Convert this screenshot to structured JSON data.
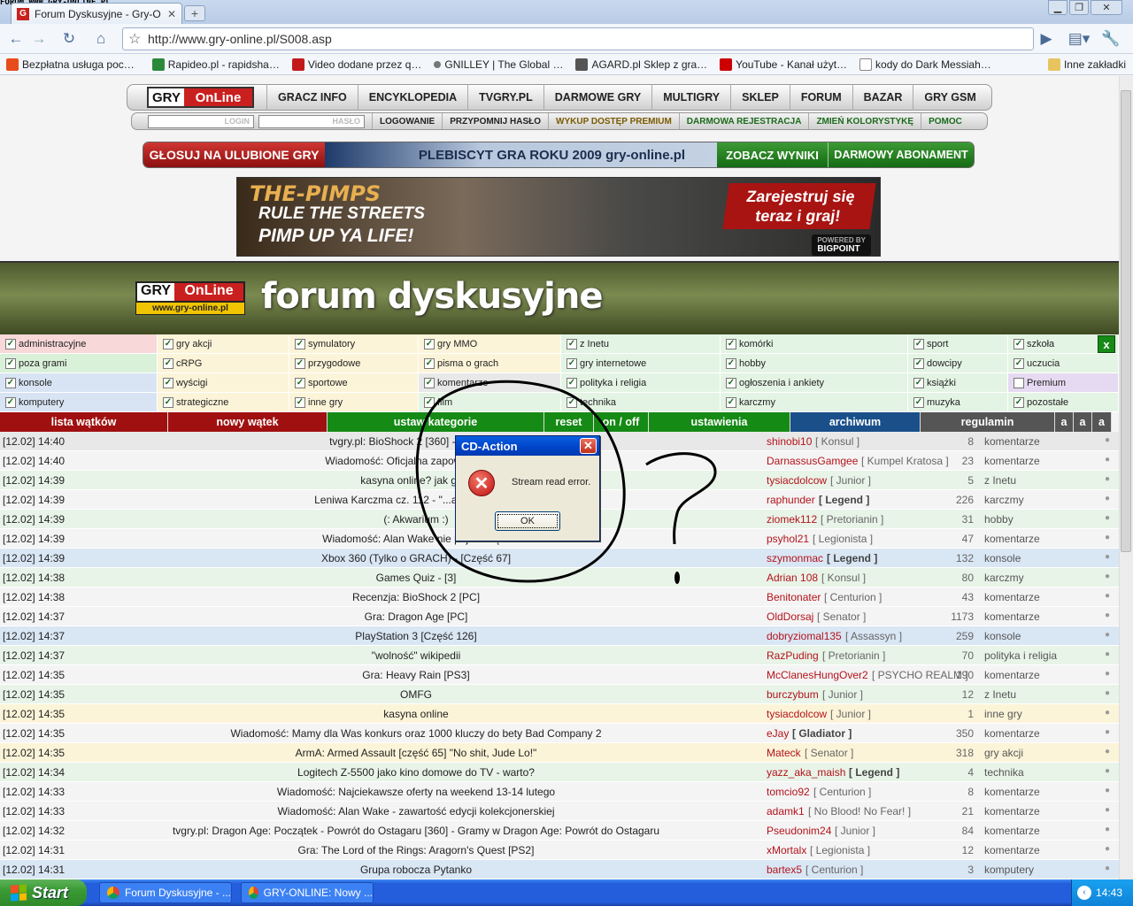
{
  "browser": {
    "watermark": "FORUM.WWW.GRY-ONLINE.PL",
    "tab_title": "Forum Dyskusyjne - Gry-O…",
    "favicon_letter": "G",
    "url": "http://www.gry-online.pl/S008.asp",
    "bookmarks": [
      {
        "label": "Bezpłatna usługa poc…",
        "color": "#e84c1c"
      },
      {
        "label": "Rapideo.pl - rapidsha…",
        "color": "#2a8a3a"
      },
      {
        "label": "Video dodane przez q…",
        "color": "#c21a1a"
      },
      {
        "label": "GNILLEY | The Global …",
        "color": "#777777"
      },
      {
        "label": "AGARD.pl Sklep z gra…",
        "color": "#555555"
      },
      {
        "label": "YouTube - Kanał użyt…",
        "color": "#cc0000"
      },
      {
        "label": "kody do Dark Messiah…",
        "color": "#ffffff"
      }
    ],
    "other_bookmarks": "Inne zakładki"
  },
  "site": {
    "logo_gry": "GRY",
    "logo_online": "OnLine",
    "nav": [
      "GRACZ INFO",
      "ENCYKLOPEDIA",
      "TVGRY.PL",
      "DARMOWE GRY",
      "MULTIGRY",
      "SKLEP",
      "FORUM",
      "BAZAR",
      "GRY GSM"
    ],
    "login_placeholder": "LOGIN",
    "password_placeholder": "HASŁO",
    "subnav": [
      "LOGOWANIE",
      "PRZYPOMNIJ HASŁO",
      "WYKUP DOSTĘP PREMIUM",
      "DARMOWA REJESTRACJA",
      "ZMIEŃ KOLORYSTYKĘ",
      "POMOC"
    ],
    "vote": {
      "left": "GŁOSUJ NA ULUBIONE GRY",
      "middle": "PLEBISCYT GRA ROKU 2009 gry-online.pl",
      "results": "ZOBACZ WYNIKI",
      "subscription": "DARMOWY ABONAMENT"
    },
    "banner": {
      "brand": "THE-PIMPS",
      "line1": "RULE THE STREETS",
      "line2": "PIMP UP YA LIFE!",
      "cta": "Zarejestruj się teraz i graj!",
      "powered": "POWERED BY",
      "bigpoint": "BIGPOINT"
    },
    "forum_title": "forum dyskusyjne",
    "logo_url": "www.gry-online.pl"
  },
  "categories": [
    [
      {
        "label": "administracyjne",
        "checked": true,
        "bg": "#f8d8d8"
      },
      {
        "label": "gry akcji",
        "checked": true,
        "bg": "#fcf4d8"
      },
      {
        "label": "symulatory",
        "checked": true,
        "bg": "#fcf4d8"
      },
      {
        "label": "gry MMO",
        "checked": true,
        "bg": "#fcf4d8"
      },
      {
        "label": "z Inetu",
        "checked": true,
        "bg": "#e4f4e4"
      },
      {
        "label": "komórki",
        "checked": true,
        "bg": "#e4f4e4"
      },
      {
        "label": "sport",
        "checked": true,
        "bg": "#e4f4e4"
      },
      {
        "label": "szkoła",
        "checked": true,
        "bg": "#e4f4e4"
      }
    ],
    [
      {
        "label": "poza grami",
        "checked": true,
        "bg": "#d9f0d9"
      },
      {
        "label": "cRPG",
        "checked": true,
        "bg": "#fcf4d8"
      },
      {
        "label": "przygodowe",
        "checked": true,
        "bg": "#fcf4d8"
      },
      {
        "label": "pisma o grach",
        "checked": true,
        "bg": "#fcf4d8"
      },
      {
        "label": "gry internetowe",
        "checked": true,
        "bg": "#e4f4e4"
      },
      {
        "label": "hobby",
        "checked": true,
        "bg": "#e4f4e4"
      },
      {
        "label": "dowcipy",
        "checked": true,
        "bg": "#e4f4e4"
      },
      {
        "label": "uczucia",
        "checked": true,
        "bg": "#e4f4e4"
      }
    ],
    [
      {
        "label": "konsole",
        "checked": true,
        "bg": "#d8e4f4"
      },
      {
        "label": "wyścigi",
        "checked": true,
        "bg": "#fcf4d8"
      },
      {
        "label": "sportowe",
        "checked": true,
        "bg": "#fcf4d8"
      },
      {
        "label": "komentarze",
        "checked": true,
        "bg": "#e8e8e8"
      },
      {
        "label": "polityka i religia",
        "checked": true,
        "bg": "#e4f4e4"
      },
      {
        "label": "ogłoszenia i ankiety",
        "checked": true,
        "bg": "#e4f4e4"
      },
      {
        "label": "książki",
        "checked": true,
        "bg": "#e4f4e4"
      },
      {
        "label": "Premium",
        "checked": false,
        "bg": "#e6daf2"
      }
    ],
    [
      {
        "label": "komputery",
        "checked": true,
        "bg": "#d8e4f4"
      },
      {
        "label": "strategiczne",
        "checked": true,
        "bg": "#fcf4d8"
      },
      {
        "label": "inne gry",
        "checked": true,
        "bg": "#fcf4d8"
      },
      {
        "label": "film",
        "checked": true,
        "bg": "#e4f4e4"
      },
      {
        "label": "technika",
        "checked": true,
        "bg": "#e4f4e4"
      },
      {
        "label": "karczmy",
        "checked": true,
        "bg": "#e4f4e4"
      },
      {
        "label": "muzyka",
        "checked": true,
        "bg": "#e4f4e4"
      },
      {
        "label": "pozostałe",
        "checked": true,
        "bg": "#e4f4e4"
      }
    ]
  ],
  "category_close": "x",
  "forum_toolbar": [
    {
      "label": "lista wątków",
      "color": "#a01010"
    },
    {
      "label": "nowy wątek",
      "color": "#a01010"
    },
    {
      "label": "ustaw kategorie",
      "color": "#158a15"
    },
    {
      "label": "reset",
      "color": "#158a15"
    },
    {
      "label": "on / off",
      "color": "#158a15"
    },
    {
      "label": "ustawienia",
      "color": "#158a15"
    },
    {
      "label": "archiwum",
      "color": "#1a4f8a"
    },
    {
      "label": "regulamin",
      "color": "#555555"
    },
    {
      "label": "a",
      "color": "#555555"
    },
    {
      "label": "a",
      "color": "#555555"
    },
    {
      "label": "a",
      "color": "#555555"
    }
  ],
  "threads": [
    {
      "time": "[12.02] 14:40",
      "title": "tvgry.pl: BioShock 2 [360] - Recenzja",
      "user": "shinobi10",
      "rank": "[ Konsul ]",
      "count": "8",
      "cat": "komentarze",
      "bg": "#e8e8e8"
    },
    {
      "time": "[12.02] 14:40",
      "title": "Wiadomość: Oficjalna zapowiedź Kill...",
      "user": "DarnassusGamgee",
      "rank": "[ Kumpel Kratosa ]",
      "count": "23",
      "cat": "komentarze",
      "bg": "#f4f4f4"
    },
    {
      "time": "[12.02] 14:39",
      "title": "kasyna online? jak grać",
      "user": "tysiacdolcow",
      "rank": "[ Junior ]",
      "count": "5",
      "cat": "z Inetu",
      "bg": "#e8f4e8"
    },
    {
      "time": "[12.02] 14:39",
      "title": "Leniwa Karczma cz. 112 - \"...a najlepsza...\"",
      "user": "raphunder",
      "rank": "[ Legend ]",
      "count": "226",
      "cat": "karczmy",
      "bg": "#f4f4f4"
    },
    {
      "time": "[12.02] 14:39",
      "title": "(: Akwarium :)",
      "user": "ziomek112",
      "rank": "[ Pretorianin ]",
      "count": "31",
      "cat": "hobby",
      "bg": "#e8f4e8"
    },
    {
      "time": "[12.02] 14:39",
      "title": "Wiadomość: Alan Wake nie pojawi się...",
      "user": "psyhol21",
      "rank": "[ Legionista ]",
      "count": "47",
      "cat": "komentarze",
      "bg": "#f4f4f4"
    },
    {
      "time": "[12.02] 14:39",
      "title": "Xbox 360 (Tylko o GRACH) - [Część 67]",
      "user": "szymonmac",
      "rank": "[ Legend ]",
      "count": "132",
      "cat": "konsole",
      "bg": "#d9e6f4"
    },
    {
      "time": "[12.02] 14:38",
      "title": "Games Quiz - [3]",
      "user": "Adrian 108",
      "rank": "[ Konsul ]",
      "count": "80",
      "cat": "karczmy",
      "bg": "#e8f4e8"
    },
    {
      "time": "[12.02] 14:38",
      "title": "Recenzja: BioShock 2 [PC]",
      "user": "Benitonater",
      "rank": "[ Centurion ]",
      "count": "43",
      "cat": "komentarze",
      "bg": "#f4f4f4"
    },
    {
      "time": "[12.02] 14:37",
      "title": "Gra: Dragon Age [PC]",
      "user": "OldDorsaj",
      "rank": "[ Senator ]",
      "count": "1173",
      "cat": "komentarze",
      "bg": "#f4f4f4"
    },
    {
      "time": "[12.02] 14:37",
      "title": "PlayStation 3 [Część 126]",
      "user": "dobryziomal135",
      "rank": "[ Assassyn ]",
      "count": "259",
      "cat": "konsole",
      "bg": "#d9e6f4"
    },
    {
      "time": "[12.02] 14:37",
      "title": "\"wolność\" wikipedii",
      "user": "RazPuding",
      "rank": "[ Pretorianin ]",
      "count": "70",
      "cat": "polityka i religia",
      "bg": "#e8f4e8"
    },
    {
      "time": "[12.02] 14:35",
      "title": "Gra: Heavy Rain [PS3]",
      "user": "McClanesHungOver2",
      "rank": "[ PSYCHO REALM ]",
      "count": "190",
      "cat": "komentarze",
      "bg": "#f4f4f4"
    },
    {
      "time": "[12.02] 14:35",
      "title": "OMFG",
      "user": "burczybum",
      "rank": "[ Junior ]",
      "count": "12",
      "cat": "z Inetu",
      "bg": "#e8f4e8"
    },
    {
      "time": "[12.02] 14:35",
      "title": "kasyna online",
      "user": "tysiacdolcow",
      "rank": "[ Junior ]",
      "count": "1",
      "cat": "inne gry",
      "bg": "#fcf4d8"
    },
    {
      "time": "[12.02] 14:35",
      "title": "Wiadomość: Mamy dla Was konkurs oraz 1000 kluczy do bety Bad Company 2",
      "user": "eJay",
      "rank": "[ Gladiator ]",
      "count": "350",
      "cat": "komentarze",
      "bg": "#f4f4f4"
    },
    {
      "time": "[12.02] 14:35",
      "title": "ArmA: Armed Assault [część 65] \"No shit, Jude Lo!\"",
      "user": "Mateck",
      "rank": "[ Senator ]",
      "count": "318",
      "cat": "gry akcji",
      "bg": "#fcf4d8"
    },
    {
      "time": "[12.02] 14:34",
      "title": "Logitech Z-5500 jako kino domowe do TV - warto?",
      "user": "yazz_aka_maish",
      "rank": "[ Legend ]",
      "count": "4",
      "cat": "technika",
      "bg": "#e8f4e8"
    },
    {
      "time": "[12.02] 14:33",
      "title": "Wiadomość: Najciekawsze oferty na weekend 13-14 lutego",
      "user": "tomcio92",
      "rank": "[ Centurion ]",
      "count": "8",
      "cat": "komentarze",
      "bg": "#f4f4f4"
    },
    {
      "time": "[12.02] 14:33",
      "title": "Wiadomość: Alan Wake - zawartość edycji kolekcjonerskiej",
      "user": "adamk1",
      "rank": "[ No Blood! No Fear! ]",
      "count": "21",
      "cat": "komentarze",
      "bg": "#f4f4f4"
    },
    {
      "time": "[12.02] 14:32",
      "title": "tvgry.pl: Dragon Age: Początek - Powrót do Ostagaru [360] - Gramy w Dragon Age: Powrót do Ostagaru",
      "user": "Pseudonim24",
      "rank": "[ Junior ]",
      "count": "84",
      "cat": "komentarze",
      "bg": "#f4f4f4"
    },
    {
      "time": "[12.02] 14:31",
      "title": "Gra: The Lord of the Rings: Aragorn's Quest [PS2]",
      "user": "xMortalx",
      "rank": "[ Legionista ]",
      "count": "12",
      "cat": "komentarze",
      "bg": "#f4f4f4"
    },
    {
      "time": "[12.02] 14:31",
      "title": "Grupa robocza Pytanko",
      "user": "bartex5",
      "rank": "[ Centurion ]",
      "count": "3",
      "cat": "komputery",
      "bg": "#d9e6f4"
    }
  ],
  "dialog": {
    "title": "CD-Action",
    "message": "Stream read error.",
    "ok": "OK",
    "icon": "error-icon"
  },
  "taskbar": {
    "start": "Start",
    "tasks": [
      "Forum Dyskusyjne - ...",
      "GRY-ONLINE: Nowy ..."
    ],
    "clock": "14:43"
  }
}
